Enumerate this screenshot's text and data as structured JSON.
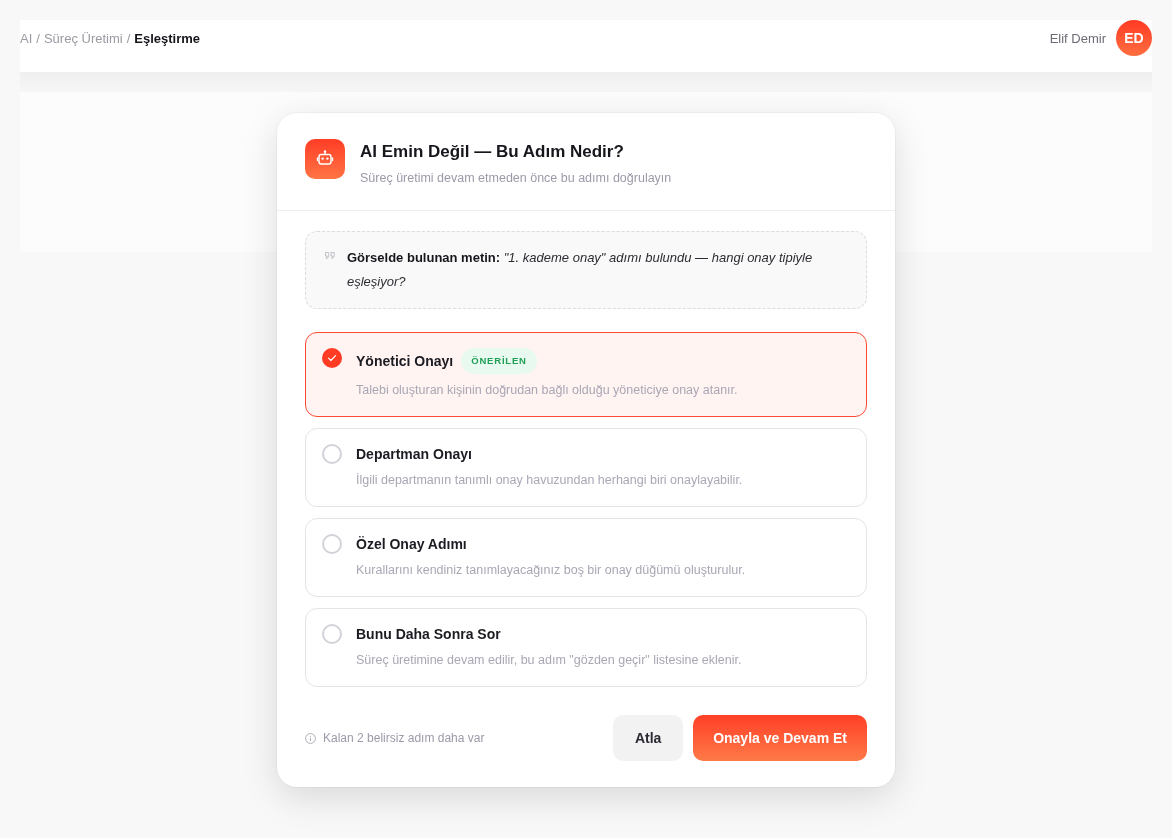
{
  "breadcrumb": {
    "separator": "/",
    "items": [
      {
        "label": "AI",
        "current": false
      },
      {
        "label": "Süreç Üretimi",
        "current": false
      },
      {
        "label": "Eşleştirme",
        "current": true
      }
    ]
  },
  "user": {
    "name": "Elif Demir",
    "initials": "ED"
  },
  "dialog": {
    "title": "AI Emin Değil — Bu Adım Nedir?",
    "subtitle": "Süreç üretimi devam etmeden önce bu adımı doğrulayın",
    "detected_text": "**Görselde bulunan metin:** *\"1. kademe onay\" adımı bulundu — hangi onay tipiyle eşleşiyor?*",
    "options": [
      {
        "title": "Yönetici Onayı",
        "badge": "ÖNERİLEN",
        "description": "Talebi oluşturan kişinin doğrudan bağlı olduğu yöneticiye onay atanır.",
        "selected": true
      },
      {
        "title": "Departman Onayı",
        "description": "İlgili departmanın tanımlı onay havuzundan herhangi biri onaylayabilir.",
        "selected": false
      },
      {
        "title": "Özel Onay Adımı",
        "description": "Kurallarını kendiniz tanımlayacağınız boş bir onay düğümü oluşturulur.",
        "selected": false
      },
      {
        "title": "Bunu Daha Sonra Sor",
        "description": "Süreç üretimine devam edilir, bu adım \"gözden geçir\" listesine eklenir.",
        "selected": false
      }
    ],
    "remaining_note": "Kalan 2 belirsiz adım daha var",
    "buttons": [
      {
        "label": "Atla",
        "kind": "secondary"
      },
      {
        "label": "Onayla ve Devam Et",
        "kind": "primary"
      }
    ]
  }
}
